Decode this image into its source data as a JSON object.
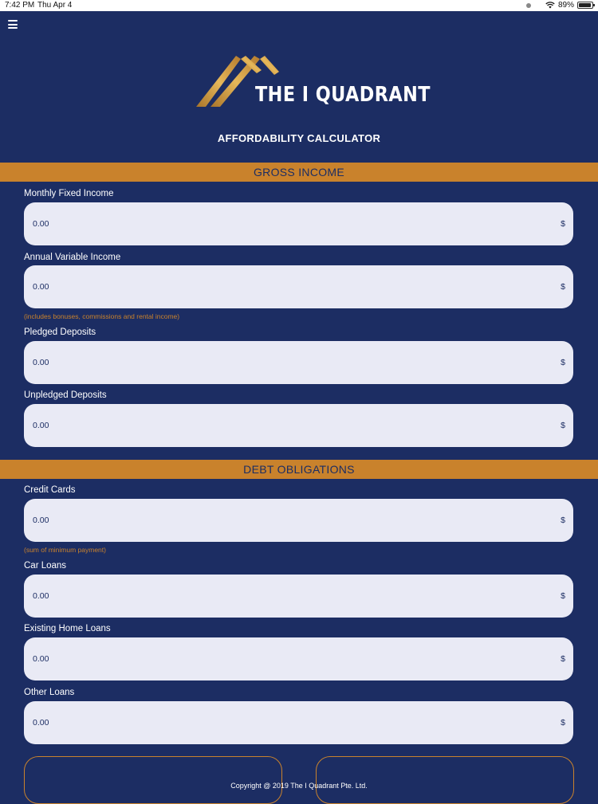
{
  "status": {
    "time": "7:42 PM",
    "date": "Thu Apr 4",
    "battery": "89%"
  },
  "brand": {
    "name": "THE I QUADRANT"
  },
  "page": {
    "title": "AFFORDABILITY CALCULATOR"
  },
  "currency_symbol": "$",
  "sections": [
    {
      "title": "GROSS INCOME",
      "fields": [
        {
          "label": "Monthly Fixed Income",
          "value": "0.00"
        },
        {
          "label": "Annual Variable Income",
          "value": "0.00",
          "hint": "(includes bonuses, commissions and rental income)"
        },
        {
          "label": "Pledged Deposits",
          "value": "0.00"
        },
        {
          "label": "Unpledged Deposits",
          "value": "0.00"
        }
      ]
    },
    {
      "title": "DEBT OBLIGATIONS",
      "fields": [
        {
          "label": "Credit Cards",
          "value": "0.00",
          "hint": "(sum of minimum payment)"
        },
        {
          "label": "Car Loans",
          "value": "0.00"
        },
        {
          "label": "Existing Home Loans",
          "value": "0.00"
        },
        {
          "label": "Other Loans",
          "value": "0.00"
        }
      ]
    }
  ],
  "footer": {
    "copyright": "Copyright @ 2019 The I Quadrant Pte. Ltd."
  },
  "colors": {
    "background": "#1c2d63",
    "accent": "#c9822c",
    "field": "#e9eaf5"
  }
}
